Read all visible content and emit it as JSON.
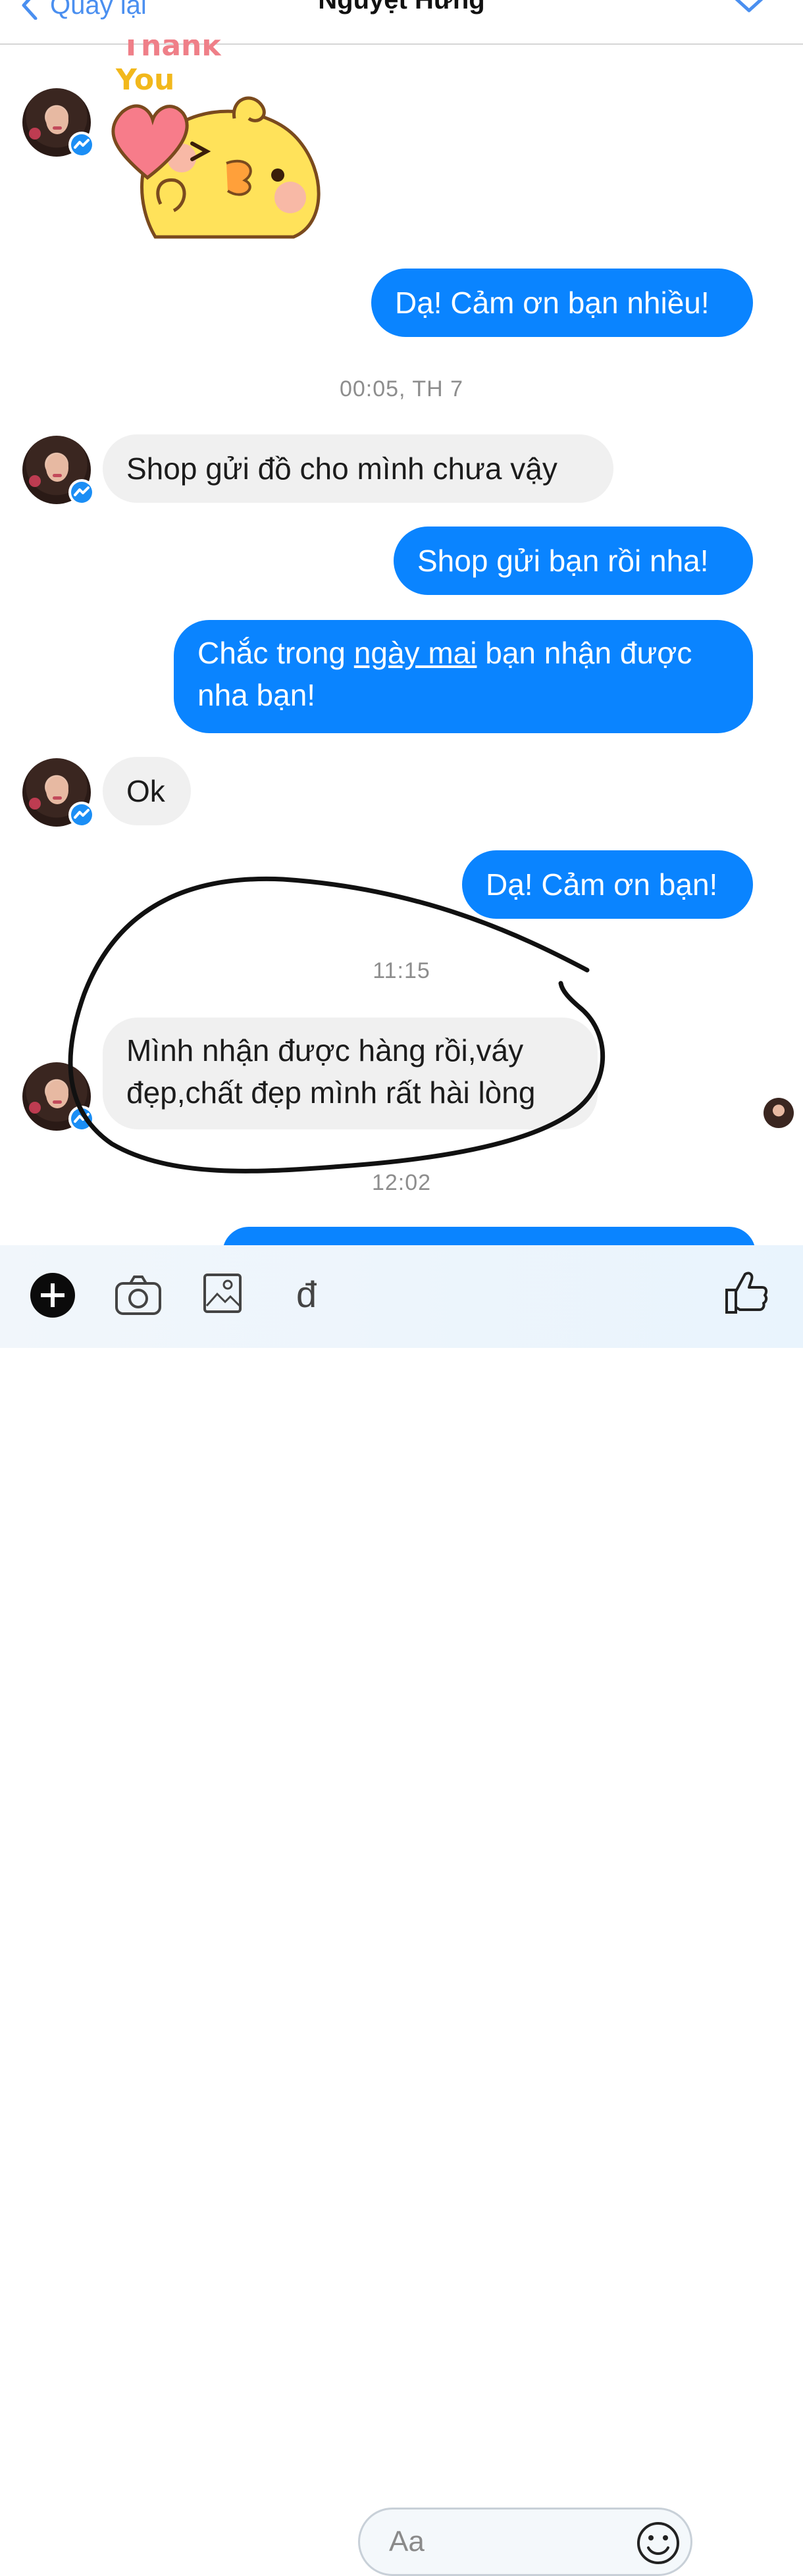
{
  "header": {
    "back_label": "Quay lại",
    "title": "Nguyệt Hưng"
  },
  "sticker": {
    "line1": "Thank",
    "line2": "You"
  },
  "messages": [
    {
      "dir": "out",
      "text": "Dạ! Cảm ơn bạn nhiều!"
    },
    {
      "dir": "ts",
      "text": "00:05, TH 7"
    },
    {
      "dir": "in",
      "text": "Shop gửi đồ cho mình chưa vậy"
    },
    {
      "dir": "out",
      "text": "Shop gửi bạn rồi nha!"
    },
    {
      "dir": "out",
      "line1_pre": "Chắc trong ",
      "line1_link": "ngày mai",
      "line1_post": " bạn nhận được",
      "line2": "nha bạn!"
    },
    {
      "dir": "in",
      "text": "Ok"
    },
    {
      "dir": "out",
      "text": "Dạ! Cảm ơn bạn!"
    },
    {
      "dir": "ts",
      "text": "11:15"
    },
    {
      "dir": "in",
      "line1": "Mình nhận được hàng rồi,váy",
      "line2": "đẹp,chất đẹp mình rất hài lòng"
    },
    {
      "dir": "ts",
      "text": "12:02"
    }
  ],
  "composer": {
    "placeholder": "Aa",
    "currency_icon_glyph": "đ",
    "icons": [
      "plus-icon",
      "camera-icon",
      "image-icon",
      "dong-icon",
      "smiley-icon",
      "thumbs-up-icon"
    ]
  },
  "colors": {
    "outgoing_bubble": "#0a84ff",
    "incoming_bubble": "#f0f0f0",
    "accent": "#4a8ff0",
    "annotation": "#111111"
  }
}
